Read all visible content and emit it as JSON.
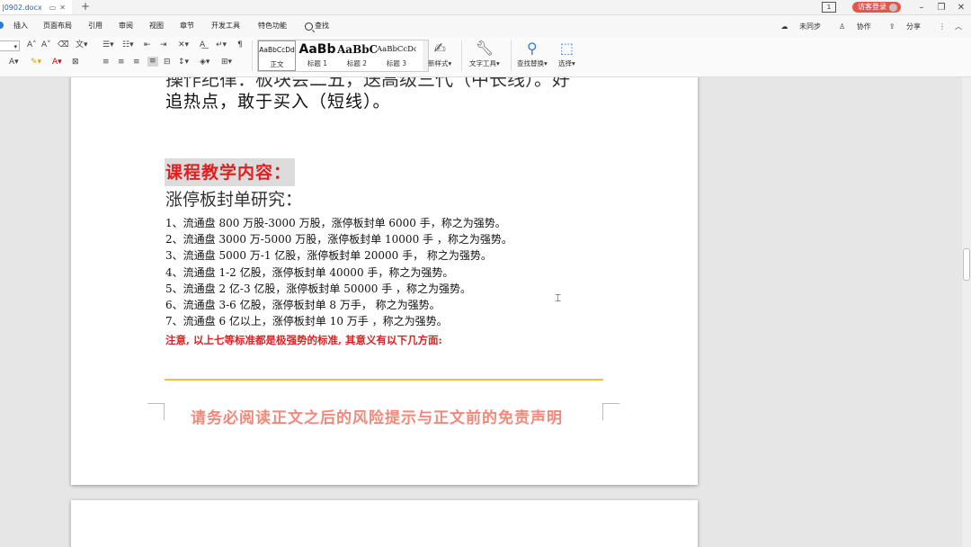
{
  "titlebar": {
    "doc_name": "|0902.docx",
    "page_count": "1",
    "login": "访客登录",
    "win_min": "–",
    "win_restore": "❐",
    "win_close": "✕",
    "new_tab": "+"
  },
  "menu": {
    "items": [
      "插入",
      "页面布局",
      "引用",
      "审阅",
      "视图",
      "章节",
      "开发工具",
      "特色功能"
    ],
    "search": "查找",
    "right": {
      "sync": "未同步",
      "collab": "协作",
      "share": "分享",
      "more": "⋮",
      "caret": "︿"
    }
  },
  "ribbon": {
    "styles": [
      {
        "preview": "AaBbCcDd",
        "label": "正文"
      },
      {
        "preview": "AaBb",
        "label": "标题 1"
      },
      {
        "preview": "AaBbC",
        "label": "标题 2"
      },
      {
        "preview": "AaBbCcDc",
        "label": "标题 3"
      }
    ],
    "new_style": "新样式",
    "text_tools": "文字工具",
    "find_replace": "查找替换",
    "select": "选择"
  },
  "document": {
    "cut_line": "操作纪律：板块会二五，送高级三代（中长线）。好",
    "line2": "追热点，敢于买入（短线）。",
    "section_heading": "课程教学内容：",
    "subheading": "涨停板封单研究：",
    "list": [
      "1、流通盘 800 万股-3000 万股，涨停板封单 6000 手，称之为强势。",
      "2、流通盘 3000 万-5000 万股，涨停板封单 10000 手 ，称之为强势。",
      "3、流通盘 5000 万-1 亿股，涨停板封单 20000 手，  称之为强势。",
      "4、流通盘 1-2 亿股，涨停板封单 40000 手，称之为强势。",
      "5、流通盘 2 亿-3 亿股，涨停板封单  50000 手     ，称之为强势。",
      "6、流通盘 3-6 亿股，涨停板封单   8 万手，  称之为强势。",
      "7、流通盘 6 亿以上，涨停板封单  10 万手    ，称之为强势。"
    ],
    "note": "注意, 以上七等标准都是极强势的标准, 其意义有以下几方面:",
    "disclaimer": "请务必阅读正文之后的风险提示与正文前的免责声明"
  },
  "colors": {
    "accent": "#2b78d9",
    "heading_red": "#e02020",
    "note_red": "#d92323",
    "disclaimer": "#ef8a7c",
    "rule": "#f0c040"
  }
}
